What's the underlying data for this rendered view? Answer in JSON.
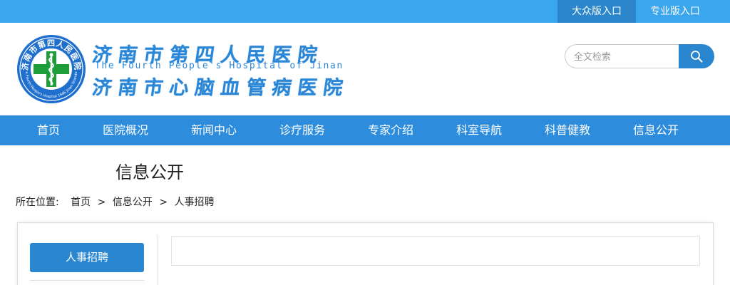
{
  "topbar": {
    "public_entry": "大众版入口",
    "pro_entry": "专业版入口"
  },
  "logo": {
    "cn_line1": "济南市第四人民医院",
    "en_line": "The Fourth People's Hospital of Jinan",
    "cn_line2": "济南市心脑血管病医院",
    "emblem_text": "济南市第四人民医院",
    "emblem_bottom": "The Fourth People's Hospital 1946 Jinan Shandong"
  },
  "search": {
    "placeholder": "全文检索",
    "icon": "search-icon"
  },
  "nav": {
    "items": [
      "首页",
      "医院概况",
      "新闻中心",
      "诊疗服务",
      "专家介绍",
      "科室导航",
      "科普健教",
      "信息公开"
    ]
  },
  "page": {
    "section_title": "信息公开"
  },
  "breadcrumb": {
    "label": "所在位置:",
    "home": "首页",
    "sep": ">",
    "level1": "信息公开",
    "current": "人事招聘"
  },
  "sidebar": {
    "active_item": "人事招聘"
  },
  "colors": {
    "topbar": "#3aa6ee",
    "topbar_active": "#2b86cc",
    "nav": "#2d8cdb",
    "brand_blue": "#2a86d6",
    "emblem_green": "#1e9e3a"
  }
}
